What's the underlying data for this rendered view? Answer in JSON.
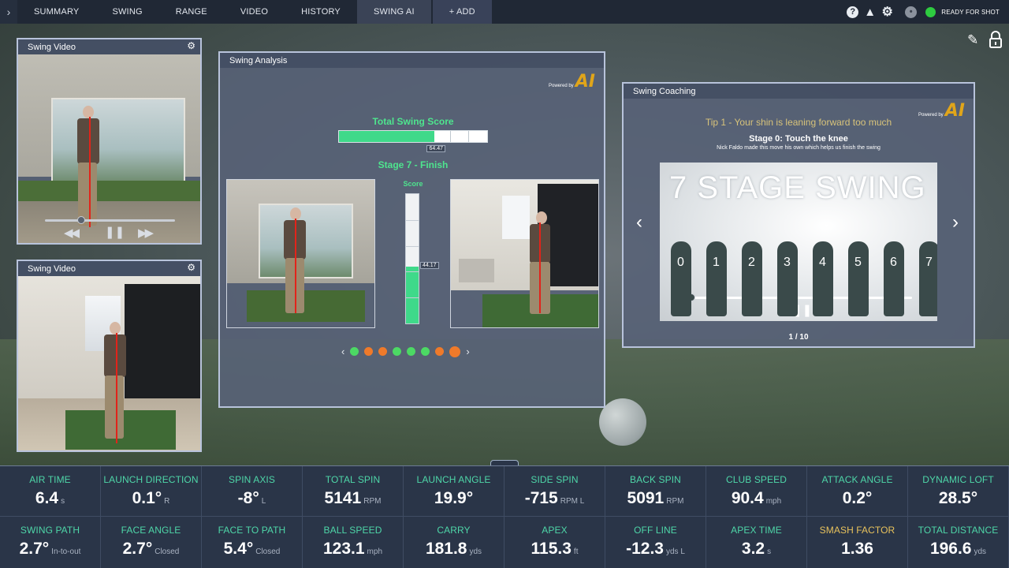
{
  "nav": {
    "tabs": [
      "SUMMARY",
      "SWING",
      "RANGE",
      "VIDEO",
      "HISTORY",
      "SWING AI",
      "+ ADD"
    ],
    "active": "SWING AI",
    "status": "READY FOR SHOT",
    "status_color": "#2ecc40",
    "icons": [
      "help-icon",
      "warning-icon",
      "gear-icon",
      "golf-ball-icon",
      "edit-icon",
      "lock-icon"
    ]
  },
  "video1": {
    "title": "Swing Video",
    "progress": 0.28
  },
  "video2": {
    "title": "Swing Video"
  },
  "analysis": {
    "title": "Swing Analysis",
    "powered_by": "Powered by",
    "ai_logo": "AI",
    "total_score_label": "Total Swing Score",
    "total_score": "64.47",
    "total_score_value": 64.47,
    "stage_label": "Stage 7 - Finish",
    "meter_label": "Score",
    "stage_score": "44.17",
    "stage_score_value": 44.17,
    "dots": [
      "#4cd964",
      "#ef7a2a",
      "#ef7a2a",
      "#4cd964",
      "#4cd964",
      "#4cd964",
      "#ef7a2a",
      "#ef7a2a"
    ],
    "active_dot": 7
  },
  "coaching": {
    "title": "Swing Coaching",
    "powered_by": "Powered by",
    "ai_logo": "AI",
    "tip": "Tip 1 - Your shin is leaning forward too much",
    "stage": "Stage 0: Touch the knee",
    "stage_sub": "Nick Faldo made this move his own which helps us finish the swing",
    "image_title": "7 STAGE SWING",
    "stage_numbers": [
      "0",
      "1",
      "2",
      "3",
      "4",
      "5",
      "6",
      "7"
    ],
    "pager": "1 / 10"
  },
  "metrics": [
    {
      "label": "AIR TIME",
      "value": "6.4",
      "unit": "s"
    },
    {
      "label": "LAUNCH DIRECTION",
      "value": "0.1°",
      "unit": "R"
    },
    {
      "label": "SPIN AXIS",
      "value": "-8°",
      "unit": "L"
    },
    {
      "label": "TOTAL SPIN",
      "value": "5141",
      "unit": "RPM"
    },
    {
      "label": "LAUNCH ANGLE",
      "value": "19.9°",
      "unit": ""
    },
    {
      "label": "SIDE SPIN",
      "value": "-715",
      "unit": "RPM L"
    },
    {
      "label": "BACK SPIN",
      "value": "5091",
      "unit": "RPM"
    },
    {
      "label": "CLUB SPEED",
      "value": "90.4",
      "unit": "mph"
    },
    {
      "label": "ATTACK ANGLE",
      "value": "0.2°",
      "unit": ""
    },
    {
      "label": "DYNAMIC LOFT",
      "value": "28.5°",
      "unit": ""
    },
    {
      "label": "SWING PATH",
      "value": "2.7°",
      "unit": "In-to-out"
    },
    {
      "label": "FACE ANGLE",
      "value": "2.7°",
      "unit": "Closed"
    },
    {
      "label": "FACE TO PATH",
      "value": "5.4°",
      "unit": "Closed"
    },
    {
      "label": "BALL SPEED",
      "value": "123.1",
      "unit": "mph"
    },
    {
      "label": "CARRY",
      "value": "181.8",
      "unit": "yds"
    },
    {
      "label": "APEX",
      "value": "115.3",
      "unit": "ft"
    },
    {
      "label": "OFF LINE",
      "value": "-12.3",
      "unit": "yds L"
    },
    {
      "label": "APEX TIME",
      "value": "3.2",
      "unit": "s"
    },
    {
      "label": "SMASH FACTOR",
      "value": "1.36",
      "unit": "",
      "gold": true
    },
    {
      "label": "TOTAL DISTANCE",
      "value": "196.6",
      "unit": "yds"
    }
  ]
}
